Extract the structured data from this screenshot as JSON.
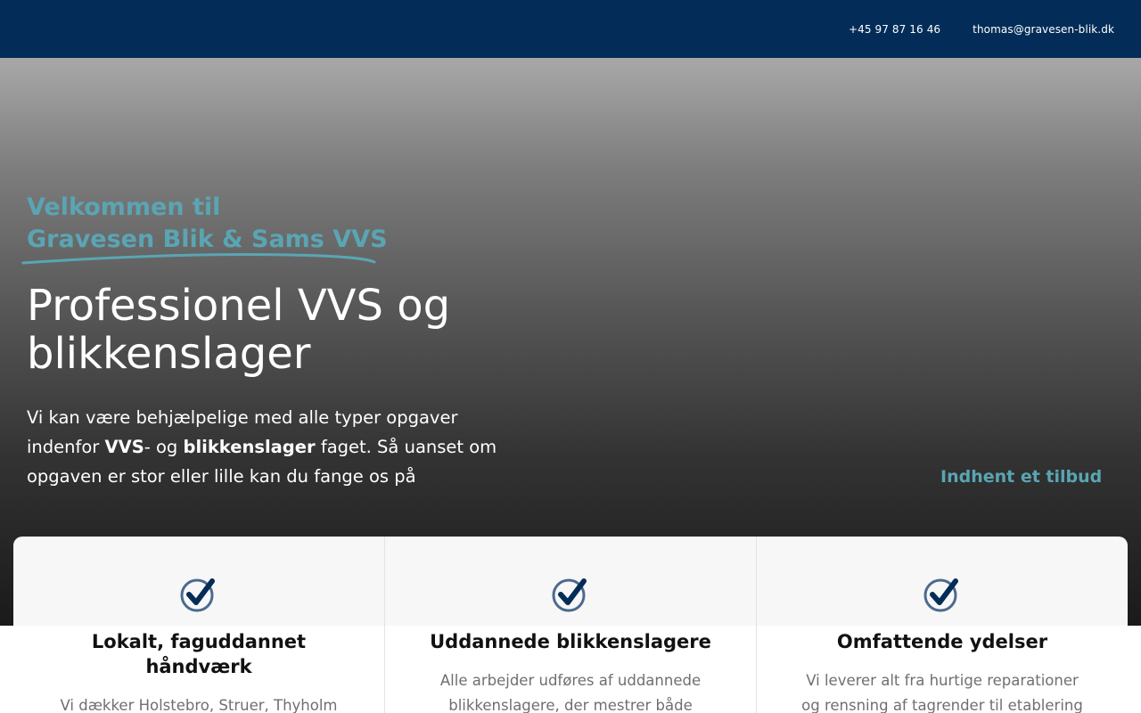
{
  "topbar": {
    "phone": "+45 97 87 16 46",
    "email": "thomas@gravesen-blik.dk",
    "background": "#032d58"
  },
  "hero": {
    "welcome_line1": "Velkommen til",
    "welcome_line2": "Gravesen Blik & Sams VVS",
    "headline_line1": "Professionel VVS og",
    "headline_line2": "blikkenslager",
    "intro_part1": "Vi kan være behjælpelige med alle typer opgaver indenfor ",
    "intro_bold1": "VVS",
    "intro_part2": "- og ",
    "intro_bold2": "blikkenslager",
    "intro_part3": " faget. Så uanset om opgaven er stor eller lille kan du fange os på",
    "cta_label": "Indhent et tilbud",
    "accent_color": "#5aa5b3"
  },
  "features": [
    {
      "icon": "checkmark-circle-icon",
      "title": "Lokalt, faguddannet håndværk",
      "text": "Vi dækker Holstebro, Struer, Thyholm"
    },
    {
      "icon": "checkmark-circle-icon",
      "title": "Uddannede blikkenslagere",
      "text": "Alle arbejder udføres af uddannede blikkenslagere, der mestrer både"
    },
    {
      "icon": "checkmark-circle-icon",
      "title": "Omfattende ydelser",
      "text": "Vi leverer alt fra hurtige reparationer og rensning af tagrender til etablering af"
    }
  ]
}
